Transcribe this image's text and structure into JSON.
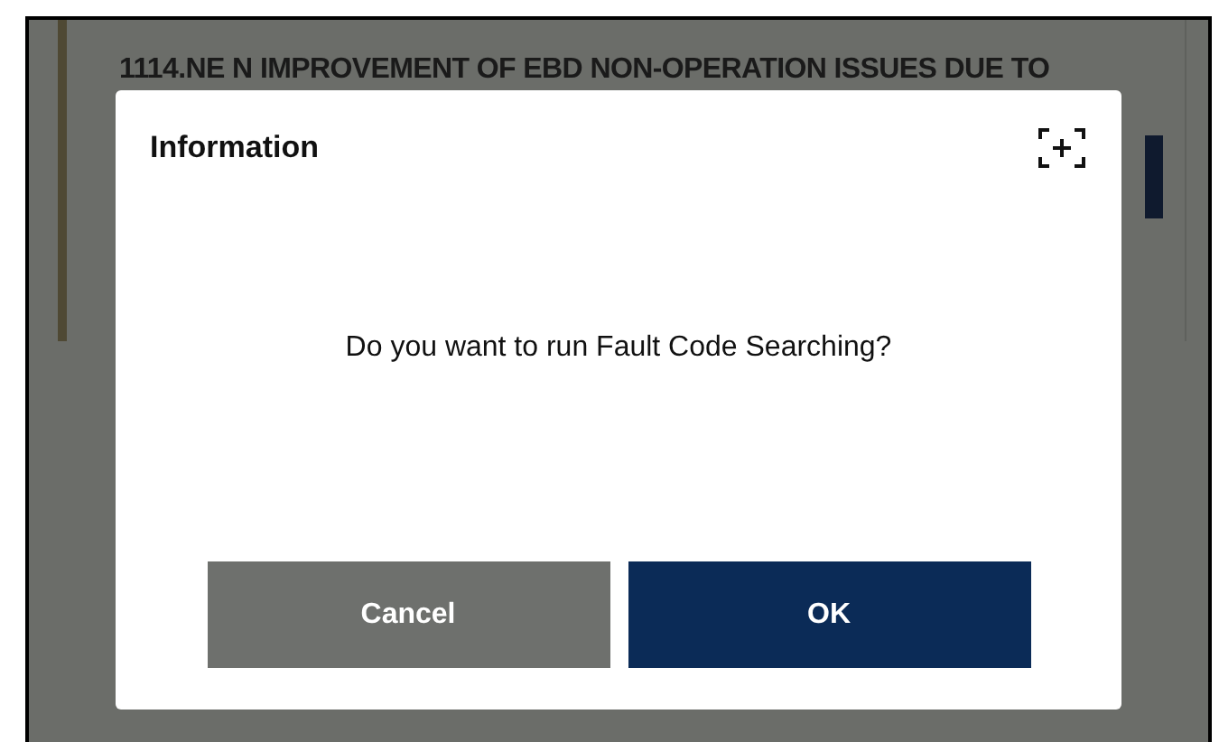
{
  "background": {
    "card_title": "1114.NE N IMPROVEMENT OF EBD NON-OPERATION ISSUES DUE TO"
  },
  "dialog": {
    "title": "Information",
    "message": "Do you want to run Fault Code Searching?",
    "buttons": [
      {
        "label": "Cancel",
        "kind": "secondary"
      },
      {
        "label": "OK",
        "kind": "primary"
      }
    ]
  }
}
